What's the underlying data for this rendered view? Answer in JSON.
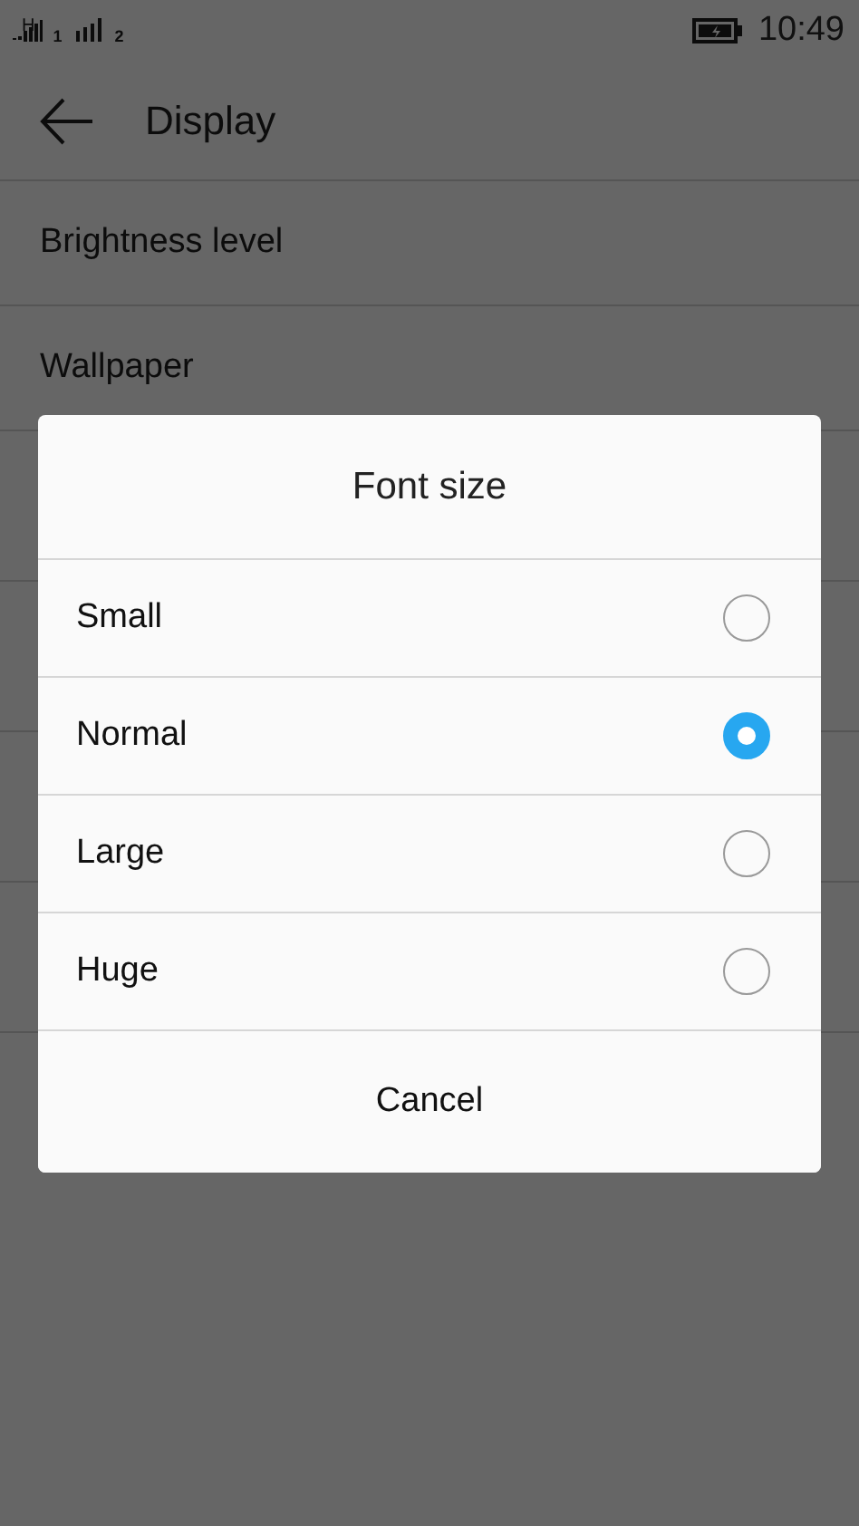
{
  "status_bar": {
    "network_type": "H",
    "sim_1": "1",
    "sim_2": "2",
    "time": "10:49"
  },
  "header": {
    "title": "Display"
  },
  "settings": [
    "Brightness level",
    "Wallpaper"
  ],
  "dialog": {
    "title": "Font size",
    "options": [
      {
        "label": "Small",
        "selected": false
      },
      {
        "label": "Normal",
        "selected": true
      },
      {
        "label": "Large",
        "selected": false
      },
      {
        "label": "Huge",
        "selected": false
      }
    ],
    "cancel": "Cancel"
  }
}
